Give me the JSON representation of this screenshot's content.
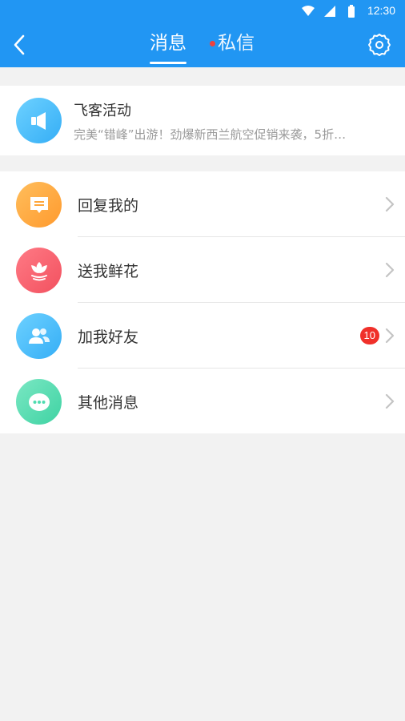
{
  "status_bar": {
    "time": "12:30",
    "icons": [
      "wifi-icon",
      "signal-icon",
      "battery-icon"
    ]
  },
  "header": {
    "tabs": [
      {
        "label": "消息",
        "active": true
      },
      {
        "label": "私信",
        "has_dot": true
      }
    ],
    "back_icon": "chevron-left-icon",
    "settings_icon": "gear-icon",
    "background_color": "#2196f3"
  },
  "activity": {
    "title": "飞客活动",
    "description": "完美“错峰”出游！劲爆新西兰航空促销来袭，5折…",
    "icon": "megaphone-icon"
  },
  "items": [
    {
      "label": "回复我的",
      "icon": "comment-icon",
      "color": "#ffa63a"
    },
    {
      "label": "送我鲜花",
      "icon": "flower-icon",
      "color": "#f45f6c"
    },
    {
      "label": "加我好友",
      "icon": "friends-icon",
      "color": "#45b9f8",
      "badge": "10"
    },
    {
      "label": "其他消息",
      "icon": "more-icon",
      "color": "#4fdcb0"
    }
  ]
}
